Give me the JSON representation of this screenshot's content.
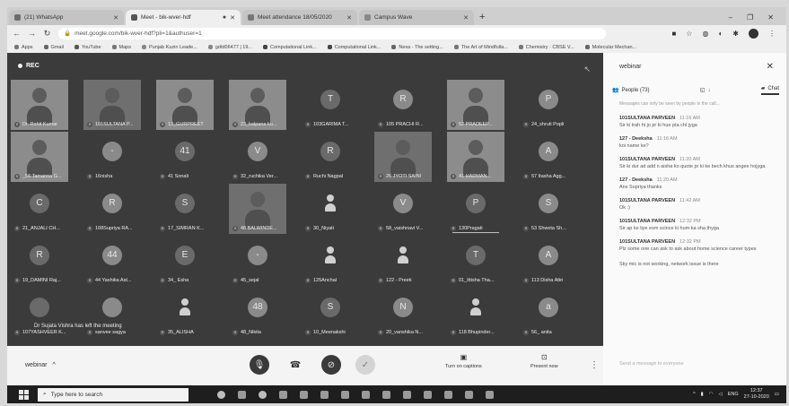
{
  "browser": {
    "tabs": [
      {
        "title": "(21) WhatsApp",
        "active": false
      },
      {
        "title": "Meet - bik-wver-hdf",
        "active": true
      },
      {
        "title": "Meet attendance 18/05/2020",
        "active": false
      },
      {
        "title": "Campus Wave",
        "active": false
      }
    ],
    "new_tab": "+",
    "url": "meet.google.com/bik-wver-hdf?pli=1&authuser=1",
    "bookmarks": [
      "Apps",
      "Gmail",
      "YouTube",
      "Maps",
      "Punjab Kuzin Leade...",
      "gdtd06477 | 19...",
      "Computational Link...",
      "Computational Link...",
      "Nexa - The setting...",
      "The Art of Mindfulla...",
      "Chemistry · CBSE V...",
      "Molecular Mechan..."
    ]
  },
  "meet": {
    "rec_label": "REC",
    "toast": "Dr Sujata Vishra has left the meeting",
    "meeting_title": "webinar",
    "captions_label": "Turn on captions",
    "present_label": "Present now",
    "tiles": [
      {
        "name": "Dr. Rohit Kumar",
        "kind": "video"
      },
      {
        "name": "101SULTANA P...",
        "kind": "video"
      },
      {
        "name": "13_GURPREET",
        "kind": "video"
      },
      {
        "name": "23_kalpana ku...",
        "kind": "video"
      },
      {
        "name": "103GARIMA T...",
        "kind": "avatar",
        "initial": "T"
      },
      {
        "name": "105 PRACHI R...",
        "kind": "avatar",
        "initial": "R"
      },
      {
        "name": "52 PRADEEP...",
        "kind": "video"
      },
      {
        "name": "24_shruti Popli",
        "kind": "avatar",
        "initial": "P"
      },
      {
        "name": "_56 Tamanna G...",
        "kind": "video"
      },
      {
        "name": "16nisha",
        "kind": "avatar",
        "initial": "-"
      },
      {
        "name": "41 Sonali",
        "kind": "avatar",
        "initial": "41"
      },
      {
        "name": "32_ruchika Ver...",
        "kind": "avatar",
        "initial": "V"
      },
      {
        "name": "Ruchi Nagpal",
        "kind": "avatar",
        "initial": "R"
      },
      {
        "name": "26 JYOTI SAINI",
        "kind": "video"
      },
      {
        "name": "41 HARMAN...",
        "kind": "video"
      },
      {
        "name": "57 Itasha Agg...",
        "kind": "avatar",
        "initial": "A"
      },
      {
        "name": "21_ANJALI CH...",
        "kind": "avatar",
        "initial": "C"
      },
      {
        "name": "108Supriya RA...",
        "kind": "avatar",
        "initial": "R"
      },
      {
        "name": "17_SIMRAN K...",
        "kind": "avatar",
        "initial": "S"
      },
      {
        "name": "48 BALWINDE...",
        "kind": "video"
      },
      {
        "name": "30_Niyati",
        "kind": "silhouette"
      },
      {
        "name": "58_vaishnavi V...",
        "kind": "avatar",
        "initial": "V"
      },
      {
        "name": "130Pragati",
        "kind": "avatar",
        "initial": "P"
      },
      {
        "name": "53 Shweta Sh...",
        "kind": "avatar",
        "initial": "S"
      },
      {
        "name": "19_DAMINI Raj...",
        "kind": "avatar",
        "initial": "R"
      },
      {
        "name": "44 Yashika Ast...",
        "kind": "avatar",
        "initial": "44"
      },
      {
        "name": "34_ Esha",
        "kind": "avatar",
        "initial": "E"
      },
      {
        "name": "45_sejal",
        "kind": "avatar",
        "initial": "-"
      },
      {
        "name": "125Anchal",
        "kind": "silhouette"
      },
      {
        "name": "122 - Preeti",
        "kind": "silhouette"
      },
      {
        "name": "01_Ittisha Tha...",
        "kind": "avatar",
        "initial": "T"
      },
      {
        "name": "113 Disha Attri",
        "kind": "avatar",
        "initial": "A"
      },
      {
        "name": "107YASHVEER K...",
        "kind": "avatar",
        "initial": ""
      },
      {
        "name": "sanvee sagya",
        "kind": "avatar",
        "initial": ""
      },
      {
        "name": "35_ALISHA",
        "kind": "silhouette"
      },
      {
        "name": "48_Nikita",
        "kind": "avatar",
        "initial": "48"
      },
      {
        "name": "10_Meenakshi",
        "kind": "avatar",
        "initial": "S"
      },
      {
        "name": "20_vanshika N...",
        "kind": "avatar",
        "initial": "N"
      },
      {
        "name": "118 Bhupinder...",
        "kind": "silhouette"
      },
      {
        "name": "56_ anita",
        "kind": "avatar",
        "initial": "a"
      }
    ]
  },
  "panel": {
    "title": "webinar",
    "people_tab": "People (73)",
    "chat_tab": "Chat",
    "note": "Messages can only be seen by people in the call...",
    "messages": [
      {
        "sender": "101SULTANA PARVEEN",
        "time": "11:16 AM",
        "text": "Sir ki trah hi jo pr ki hue pta chl jyga"
      },
      {
        "sender": "127 - Deeksha",
        "time": "11:16 AM",
        "text": "koi name ke?"
      },
      {
        "sender": "101SULTANA PARVEEN",
        "time": "11:20 AM",
        "text": "Sir ki dur ad add n aisha ko quote pr ki ke bech khus angee hojyga"
      },
      {
        "sender": "127 - Deeksha",
        "time": "11:20 AM",
        "text": "Ans Supriya thanks"
      },
      {
        "sender": "101SULTANA PARVEEN",
        "time": "11:42 AM",
        "text": "Ok :)"
      },
      {
        "sender": "101SULTANA PARVEEN",
        "time": "12:32 PM",
        "text": "Sir ap ke liye esm scince ki hum ka sha thyga"
      },
      {
        "sender": "101SULTANA PARVEEN",
        "time": "12:32 PM",
        "text": "Plz some one can ask to ask about home science career types"
      },
      {
        "sender": "",
        "time": "",
        "text": "Sky mic is not working, network issue is there"
      }
    ],
    "input_placeholder": "Send a message to everyone"
  },
  "taskbar": {
    "search_placeholder": "Type here to search",
    "lang": "ENG",
    "time": "12:37",
    "date": "27-10-2020"
  }
}
